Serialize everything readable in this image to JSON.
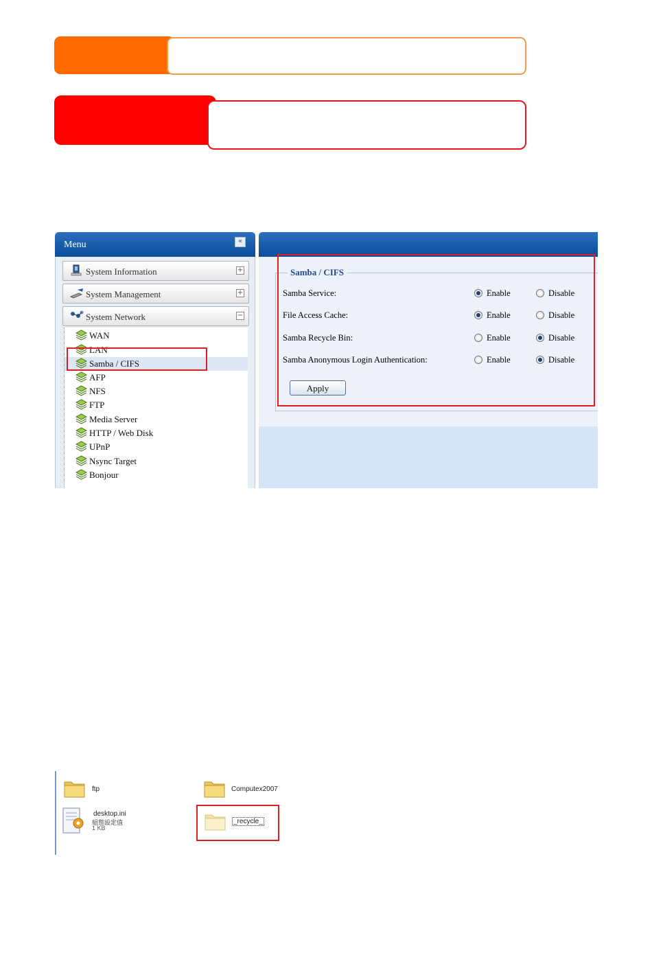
{
  "menu": {
    "title": "Menu",
    "collapse_glyph": "«",
    "sections": [
      {
        "label": "System Information",
        "toggle": "+",
        "icon": "monitor-icon"
      },
      {
        "label": "System Management",
        "toggle": "+",
        "icon": "tools-icon"
      },
      {
        "label": "System Network",
        "toggle": "−",
        "icon": "network-icon"
      }
    ],
    "network_items": [
      {
        "label": "WAN"
      },
      {
        "label": "LAN"
      },
      {
        "label": "Samba / CIFS",
        "active": true
      },
      {
        "label": "AFP"
      },
      {
        "label": "NFS"
      },
      {
        "label": "FTP"
      },
      {
        "label": "Media Server"
      },
      {
        "label": "HTTP / Web Disk"
      },
      {
        "label": "UPnP"
      },
      {
        "label": "Nsync Target"
      },
      {
        "label": "Bonjour"
      }
    ]
  },
  "samba": {
    "legend": "Samba / CIFS",
    "enable_label": "Enable",
    "disable_label": "Disable",
    "rows": [
      {
        "label": "Samba Service:",
        "value": "Enable"
      },
      {
        "label": "File Access Cache:",
        "value": "Enable"
      },
      {
        "label": "Samba Recycle Bin:",
        "value": "Disable"
      },
      {
        "label": "Samba Anonymous Login Authentication:",
        "value": "Disable"
      }
    ],
    "apply_label": "Apply"
  },
  "explorer": {
    "items": [
      {
        "name": "ftp",
        "type": "folder"
      },
      {
        "name": "Computex2007",
        "type": "folder"
      },
      {
        "name": "desktop.ini",
        "type": "config-file",
        "line2": "組態設定值",
        "line3": "1 KB"
      },
      {
        "name": "_recycle_",
        "type": "folder"
      }
    ]
  },
  "colors": {
    "orange_tab": "#ff6a00",
    "red_tab": "#ff0000",
    "header_blue": "#135aa8",
    "highlight_red": "#e02020"
  }
}
